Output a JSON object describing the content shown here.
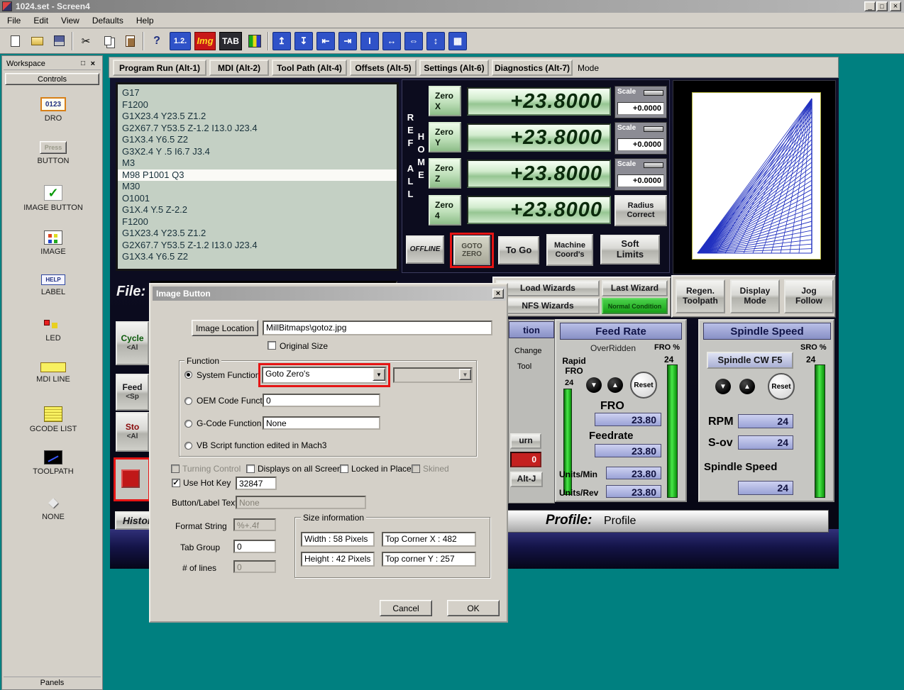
{
  "window": {
    "title": "1024.set - Screen4",
    "minimize_glyph": "_",
    "maximize_glyph": "□",
    "close_glyph": "×"
  },
  "menu": {
    "items": [
      "File",
      "Edit",
      "View",
      "Defaults",
      "Help"
    ]
  },
  "toolbar": {
    "dro_tool": "1.2.",
    "img_tool": "Img",
    "tab_tool": "TAB",
    "help_glyph": "?",
    "cut_glyph": "✂",
    "align_icons": [
      "↥",
      "↧",
      "⇤",
      "⇥",
      "Ι",
      "↔",
      "⇔",
      "↕",
      "▦"
    ]
  },
  "workspace": {
    "title": "Workspace",
    "controls_tab": "Controls",
    "panels_tab": "Panels",
    "dock_glyph": "□",
    "close_glyph": "×",
    "items": [
      "DRO",
      "BUTTON",
      "IMAGE BUTTON",
      "IMAGE",
      "LABEL",
      "LED",
      "MDI LINE",
      "GCODE LIST",
      "TOOLPATH",
      "NONE"
    ],
    "icon_texts": {
      "dro": "0123",
      "button": "Press",
      "label": "HELP",
      "check": "✓",
      "none": "◆"
    }
  },
  "screen": {
    "tabs": [
      "Program Run (Alt-1)",
      "MDI (Alt-2)",
      "Tool Path (Alt-4)",
      "Offsets (Alt-5)",
      "Settings (Alt-6)",
      "Diagnostics (Alt-7)"
    ],
    "mode_label": "Mode",
    "gcode": [
      "G17",
      "F1200",
      "G1X23.4 Y23.5 Z1.2",
      "G2X67.7 Y53.5 Z-1.2 I13.0 J23.4",
      "G1X3.4 Y6.5 Z2",
      "G3X2.4 Y .5 I6.7 J3.4",
      "M3",
      "M98 P1001 Q3",
      "M30",
      "O1001",
      "G1X.4 Y.5 Z-2.2",
      "F1200",
      "G1X23.4 Y23.5 Z1.2",
      "G2X67.7 Y53.5 Z-1.2 I13.0 J23.4",
      "G1X3.4 Y6.5 Z2"
    ],
    "ref_all_home": "REF ALL HOME",
    "zero_x": "Zero X",
    "zero_y": "Zero Y",
    "zero_z": "Zero Z",
    "zero_4": "Zero 4",
    "dro_x": "+23.8000",
    "dro_y": "+23.8000",
    "dro_z": "+23.8000",
    "dro_4": "+23.8000",
    "scale_label": "Scale",
    "scale_x": "+0.0000",
    "scale_y": "+0.0000",
    "scale_z": "+0.0000",
    "radius_correct": "Radius Correct",
    "offline": "OFFLINE",
    "goto_zero": "GOTO ZERO",
    "to_go": "To Go",
    "machine_coords": "Machine Coord's",
    "soft_limits": "Soft Limits",
    "load_wizards": "Load Wizards",
    "last_wizard": "Last Wizard",
    "nfs_wizards": "NFS Wizards",
    "normal_condition": "Normal Condition",
    "regen_toolpath": "Regen. Toolpath",
    "display_mode": "Display Mode",
    "jog_follow": "Jog Follow",
    "file_label": "File:",
    "fragments": {
      "cycle": "Cycle",
      "cycle2": "<Al",
      "feed": "Feed",
      "feed2": "<Sp",
      "stop": "Sto",
      "stop2": "<Al",
      "tion": "tion",
      "change": "Change",
      "tool": "Tool",
      "urn": "urn",
      "zero_box": "0",
      "altj": "Alt-J"
    },
    "feed_rate": {
      "title": "Feed Rate",
      "overridden": "OverRidden",
      "fro_pct": "FRO %",
      "fro_pct_value": "24",
      "rapid_label": "Rapid FRO",
      "rapid_value": "24",
      "down_glyph": "▼",
      "up_glyph": "▲",
      "reset": "Reset",
      "fro_label": "FRO",
      "fro_value": "23.80",
      "feedrate_label": "Feedrate",
      "feedrate_value": "23.80",
      "units_min": "Units/Min",
      "units_min_value": "23.80",
      "units_rev": "Units/Rev",
      "units_rev_value": "23.80"
    },
    "spindle": {
      "title": "Spindle Speed",
      "cw_button": "Spindle CW F5",
      "sro_pct": "SRO %",
      "sro_pct_value": "24",
      "down_glyph": "▼",
      "up_glyph": "▲",
      "reset": "Reset",
      "rpm_label": "RPM",
      "rpm_value": "24",
      "sov_label": "S-ov",
      "sov_value": "24",
      "speed_label": "Spindle Speed",
      "speed_value": "24"
    },
    "history": "History",
    "profile_label": "Profile:",
    "profile_value": "Profile",
    "toolpath": {
      "line_count": 34,
      "line_color": "#2030c0"
    }
  },
  "dialog": {
    "title": "Image Button",
    "close_glyph": "×",
    "image_location_button": "Image Location",
    "image_location_value": "MillBitmaps\\gotoz.jpg",
    "original_size": "Original Size",
    "function_group": "Function",
    "system_function": "System Function",
    "system_function_value": "Goto Zero's",
    "dropdown_glyph": "▼",
    "oem_label": "OEM Code Function",
    "oem_value": "0",
    "gcode_label": "G-Code Function",
    "gcode_value": "None",
    "vb_label": "VB Script function edited in Mach3",
    "turning_control": "Turning Control",
    "displays_all": "Displays on all Screens",
    "locked": "Locked in Place",
    "skined": "Skined",
    "use_hot_key": "Use Hot Key",
    "hot_key_value": "32847",
    "button_label_text": "Button/Label Text",
    "button_label_value": "None",
    "format_string_label": "Format String",
    "format_string_value": "%+.4f",
    "tab_group_label": "Tab Group",
    "tab_group_value": "0",
    "num_lines_label": "# of lines",
    "num_lines_value": "0",
    "size_group": "Size information",
    "width_value": "Width : 58 Pixels",
    "height_value": "Height : 42 Pixels",
    "top_x_value": "Top Corner X : 482",
    "top_y_value": "Top corner Y : 257",
    "cancel": "Cancel",
    "ok": "OK"
  }
}
